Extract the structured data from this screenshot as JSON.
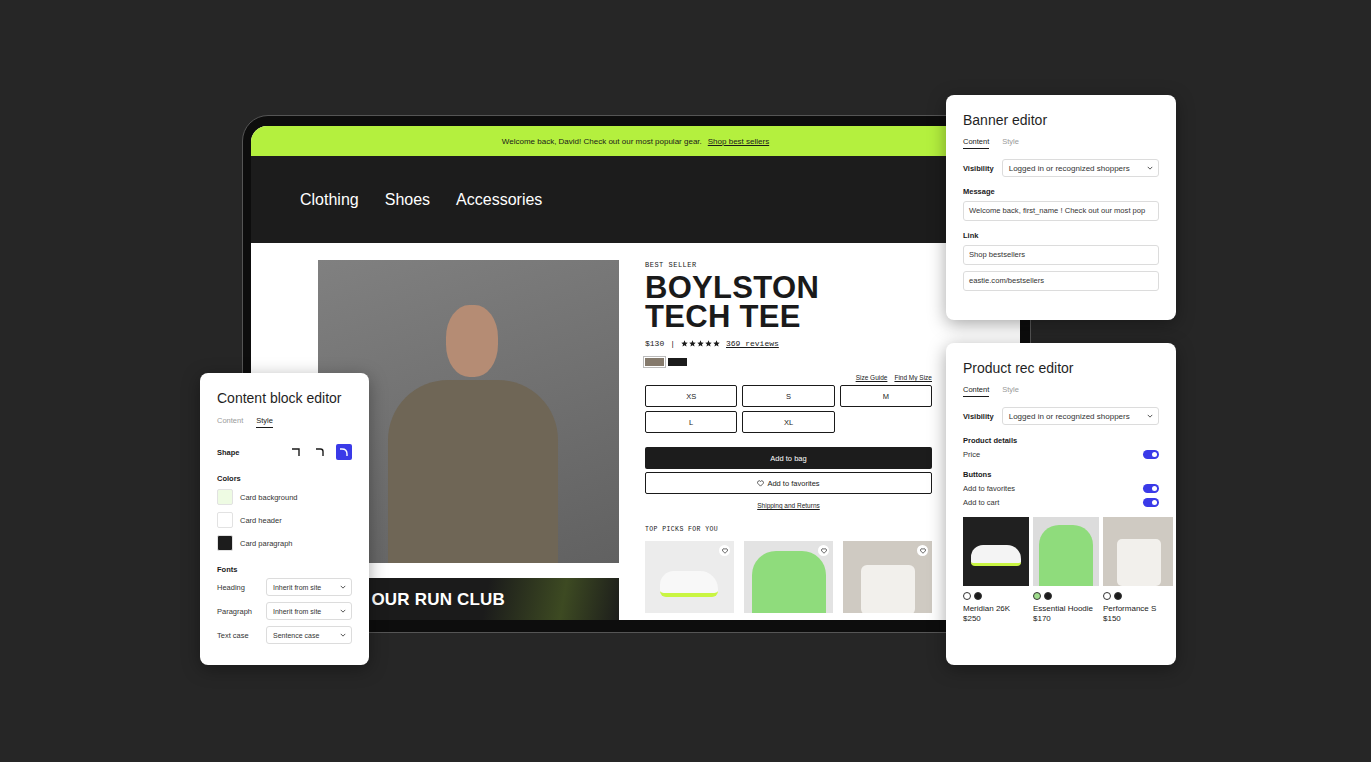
{
  "storefront": {
    "banner": {
      "message": "Welcome back, David! Check out our most popular gear.",
      "link": "Shop best sellers"
    },
    "nav": [
      {
        "label": "Clothing"
      },
      {
        "label": "Shoes"
      },
      {
        "label": "Accessories"
      }
    ],
    "product": {
      "badge": "BEST SELLER",
      "title": "BOYLSTON TECH TEE",
      "price": "$130",
      "divider": "|",
      "stars": 5,
      "reviews": "369 reviews",
      "swatches": [
        {
          "color": "#857a6c",
          "selected": true
        },
        {
          "color": "#1b1b1b",
          "selected": false
        }
      ],
      "size_links": [
        "Size Guide",
        "Find My Size"
      ],
      "sizes": [
        {
          "label": "XS",
          "selected": false
        },
        {
          "label": "S",
          "selected": false
        },
        {
          "label": "M",
          "selected": false
        },
        {
          "label": "L",
          "selected": false
        },
        {
          "label": "XL",
          "selected": false
        }
      ],
      "add_to_bag": "Add to bag",
      "add_to_favorites": "Add to favorites",
      "shipping": "Shipping and Returns"
    },
    "promo": {
      "title": "JOIN OUR RUN CLUB"
    },
    "top_picks": {
      "title": "TOP PICKS FOR YOU",
      "items": [
        {
          "favorited": false
        },
        {
          "favorited": false
        },
        {
          "favorited": false
        }
      ]
    }
  },
  "content_block_editor": {
    "title": "Content block editor",
    "tabs": [
      {
        "label": "Content",
        "selected": false
      },
      {
        "label": "Style",
        "selected": true
      }
    ],
    "shape": {
      "label": "Shape",
      "options": [
        {
          "kind": "square",
          "selected": false
        },
        {
          "kind": "rounded",
          "selected": false
        },
        {
          "kind": "round",
          "selected": true
        }
      ]
    },
    "colors": {
      "label": "Colors",
      "items": [
        {
          "label": "Card background",
          "color": "#eefbe3"
        },
        {
          "label": "Card header",
          "color": "#ffffff"
        },
        {
          "label": "Card paragraph",
          "color": "#1c1c1c"
        }
      ]
    },
    "fonts": {
      "label": "Fonts",
      "items": [
        {
          "label": "Heading",
          "value": "Inherit from site"
        },
        {
          "label": "Paragraph",
          "value": "Inherit from site"
        },
        {
          "label": "Text case",
          "value": "Sentence case"
        }
      ]
    }
  },
  "banner_editor": {
    "title": "Banner editor",
    "tabs": [
      {
        "label": "Content",
        "selected": true
      },
      {
        "label": "Style",
        "selected": false
      }
    ],
    "visibility": {
      "label": "Visibility",
      "value": "Logged in or recognized shoppers"
    },
    "message": {
      "label": "Message",
      "value": "Welcome back, first_name ! Check out our most pop"
    },
    "link": {
      "label": "Link",
      "fields": [
        "Shop bestsellers",
        "eastie.com/bestsellers"
      ]
    }
  },
  "product_rec_editor": {
    "title": "Product rec editor",
    "tabs": [
      {
        "label": "Content",
        "selected": true
      },
      {
        "label": "Style",
        "selected": false
      }
    ],
    "visibility": {
      "label": "Visibility",
      "value": "Logged in or recognized shoppers"
    },
    "groups": [
      {
        "label": "Product details",
        "toggles": [
          {
            "label": "Price",
            "on": true
          }
        ]
      },
      {
        "label": "Buttons",
        "toggles": [
          {
            "label": "Add to favorites",
            "on": true
          },
          {
            "label": "Add to cart",
            "on": true
          }
        ]
      }
    ],
    "products": [
      {
        "name": "Meridian 26K",
        "price": "$250",
        "swatches": [
          {
            "color": "#ffffff"
          },
          {
            "color": "#1b1b1b"
          }
        ]
      },
      {
        "name": "Essential Hoodie",
        "price": "$170",
        "swatches": [
          {
            "color": "#9fdc8c"
          },
          {
            "color": "#1b1b1b"
          }
        ]
      },
      {
        "name": "Performance S",
        "price": "$150",
        "swatches": [
          {
            "color": "#ffffff"
          },
          {
            "color": "#1b1b1b"
          }
        ]
      }
    ]
  }
}
